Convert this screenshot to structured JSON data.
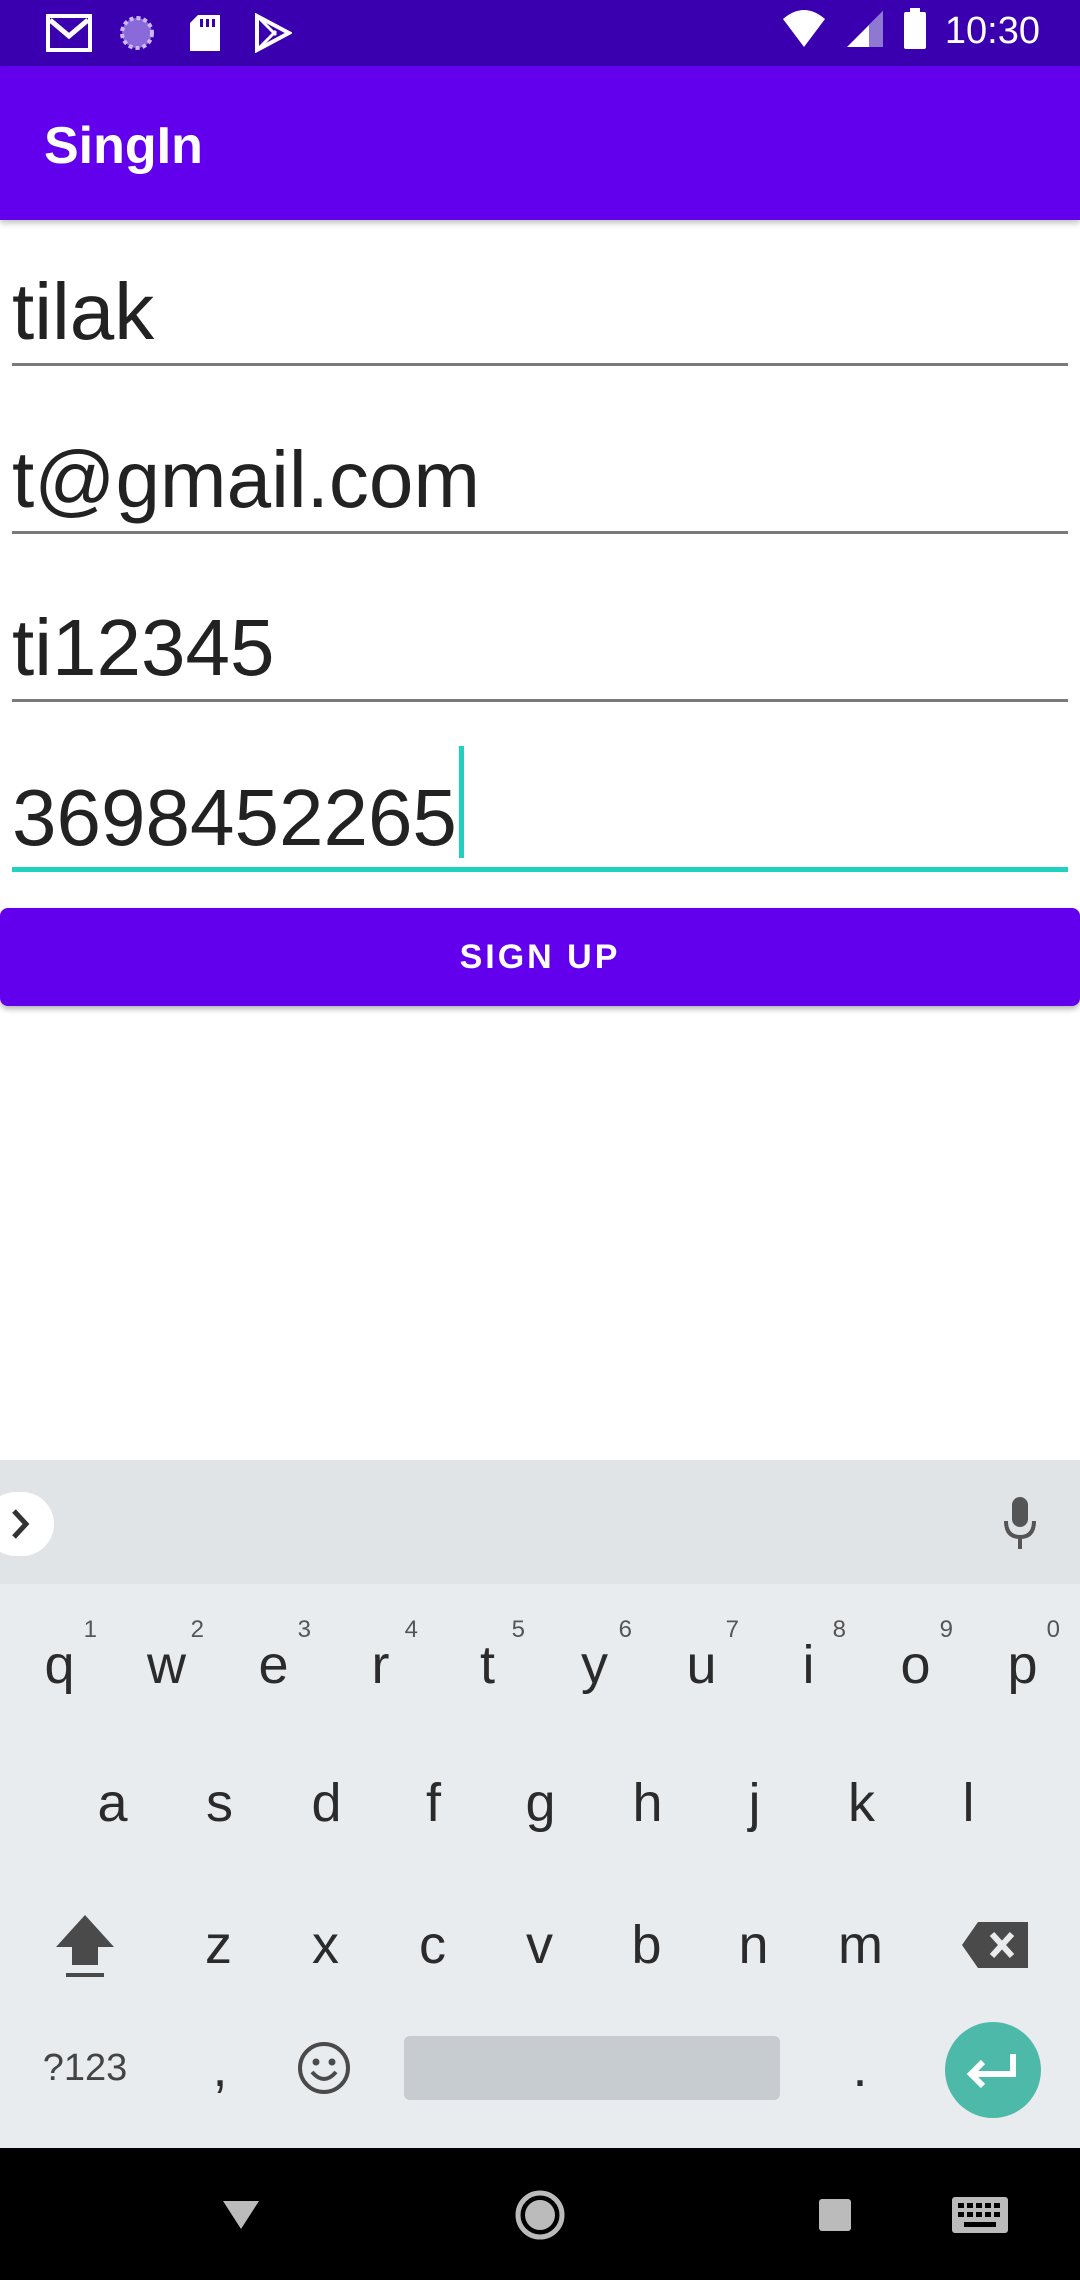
{
  "status_bar": {
    "time": "10:30",
    "left_icons": [
      "gmail-icon",
      "sync-icon",
      "sd-card-icon",
      "play-store-icon"
    ],
    "right_icons": [
      "wifi-icon",
      "signal-icon",
      "battery-icon"
    ]
  },
  "app_bar": {
    "title": "SingIn"
  },
  "form": {
    "name_value": "tilak",
    "email_value": "t@gmail.com",
    "password_value": "ti12345",
    "phone_value": "3698452265"
  },
  "signup_button": {
    "label": "SIGN UP"
  },
  "keyboard": {
    "row1": [
      {
        "k": "q",
        "h": "1"
      },
      {
        "k": "w",
        "h": "2"
      },
      {
        "k": "e",
        "h": "3"
      },
      {
        "k": "r",
        "h": "4"
      },
      {
        "k": "t",
        "h": "5"
      },
      {
        "k": "y",
        "h": "6"
      },
      {
        "k": "u",
        "h": "7"
      },
      {
        "k": "i",
        "h": "8"
      },
      {
        "k": "o",
        "h": "9"
      },
      {
        "k": "p",
        "h": "0"
      }
    ],
    "row2": [
      "a",
      "s",
      "d",
      "f",
      "g",
      "h",
      "j",
      "k",
      "l"
    ],
    "row3": [
      "z",
      "x",
      "c",
      "v",
      "b",
      "n",
      "m"
    ],
    "symbols_label": "?123",
    "comma": ",",
    "period": "."
  },
  "colors": {
    "status_bar": "#3a00b0",
    "app_bar": "#6200ee",
    "accent": "#1fd1c1",
    "enter_key": "#4dbaa9"
  }
}
